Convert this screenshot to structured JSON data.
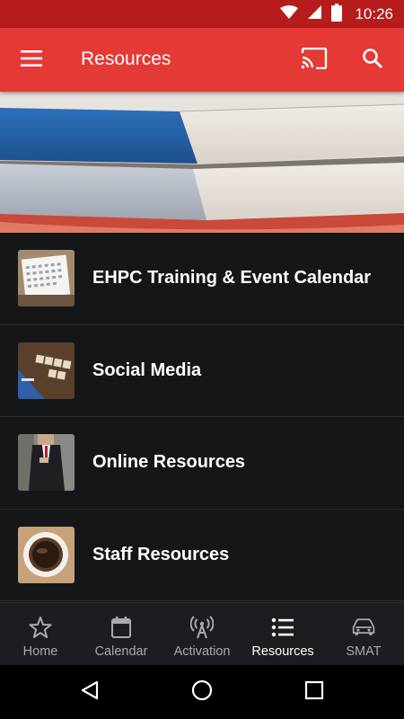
{
  "status_bar": {
    "time": "10:26",
    "icons": [
      "wifi-icon",
      "signal-icon",
      "battery-icon"
    ]
  },
  "app_bar": {
    "title": "Resources",
    "menu_icon": "hamburger-menu-icon",
    "cast_icon": "cast-icon",
    "search_icon": "search-icon",
    "color": "#e53935"
  },
  "hero": {
    "image": "stacked-books"
  },
  "list": {
    "items": [
      {
        "label": "EHPC Training & Event Calendar",
        "thumbnail": "calendar-photo"
      },
      {
        "label": "Social Media",
        "thumbnail": "social-media-tiles-photo"
      },
      {
        "label": "Online Resources",
        "thumbnail": "businessman-phone-photo"
      },
      {
        "label": "Staff Resources",
        "thumbnail": "coffee-cup-photo"
      }
    ]
  },
  "bottom_nav": {
    "items": [
      {
        "label": "Home",
        "icon": "star-icon",
        "active": false
      },
      {
        "label": "Calendar",
        "icon": "calendar-icon",
        "active": false
      },
      {
        "label": "Activation",
        "icon": "broadcast-antenna-icon",
        "active": false
      },
      {
        "label": "Resources",
        "icon": "list-icon",
        "active": true
      },
      {
        "label": "SMAT",
        "icon": "car-icon",
        "active": false
      }
    ]
  },
  "system_nav": {
    "buttons": [
      "back-icon",
      "home-icon",
      "recents-icon"
    ]
  }
}
